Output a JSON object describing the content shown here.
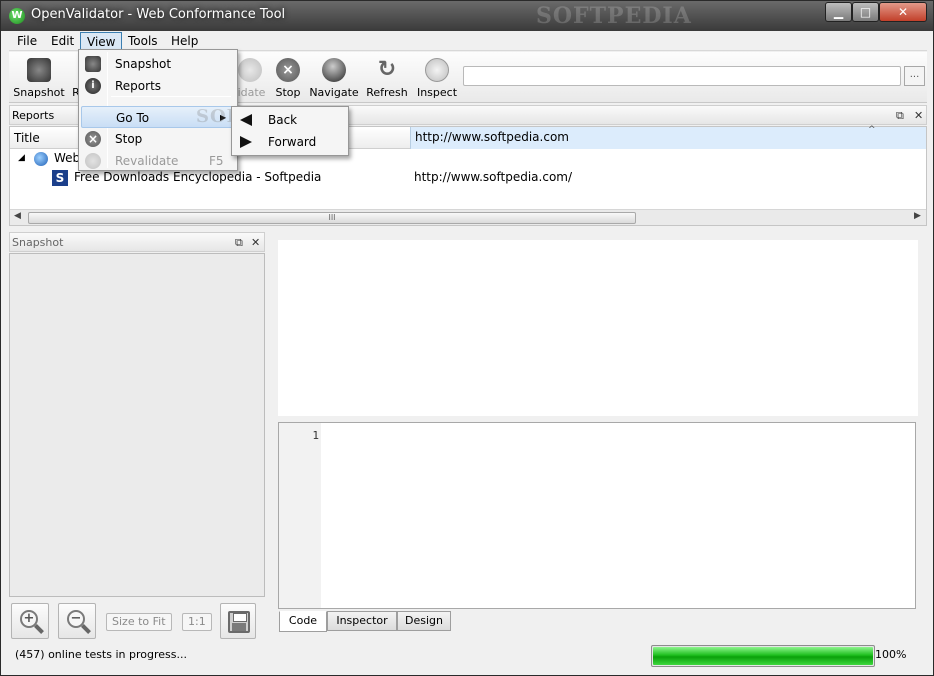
{
  "window": {
    "title": "OpenValidator - Web Conformance Tool",
    "watermark": "SOFTPEDIA",
    "min": "▁",
    "max": "□",
    "close": "✕"
  },
  "menubar": {
    "items": [
      "File",
      "Edit",
      "View",
      "Tools",
      "Help"
    ]
  },
  "toolbar": {
    "snapshot": "Snapshot",
    "reports_partial": "R",
    "revalidate_partial": "lidate",
    "stop": "Stop",
    "navigate": "Navigate",
    "refresh": "Refresh",
    "inspect": "Inspect",
    "address_value": "",
    "browse_btn": "..."
  },
  "reports_panel": {
    "header": "Reports",
    "columns": {
      "title": "Title",
      "url": "http://www.softpedia.com"
    },
    "rows": [
      {
        "title": "Web",
        "url": ""
      },
      {
        "title": "Free Downloads Encyclopedia - Softpedia",
        "url": "http://www.softpedia.com/"
      }
    ]
  },
  "snapshot_panel": {
    "header": "Snapshot",
    "size_to_fit": "Size to Fit",
    "one_to_one": "1:1"
  },
  "editor": {
    "line_number": "1"
  },
  "tabs": [
    "Code",
    "Inspector",
    "Design"
  ],
  "status": {
    "message": "(457)  online tests in progress...",
    "progress": 100,
    "progress_label": "100%"
  },
  "view_menu": {
    "items": [
      {
        "label": "Snapshot",
        "shortcut": ""
      },
      {
        "label": "Reports",
        "shortcut": ""
      },
      {
        "label": "Go To",
        "shortcut": ""
      },
      {
        "label": "Stop",
        "shortcut": ""
      },
      {
        "label": "Revalidate",
        "shortcut": "F5"
      }
    ],
    "goto_sub": [
      "Back",
      "Forward"
    ]
  },
  "colors": {
    "progress": "#1fbf1f",
    "selection": "#dcecfc"
  }
}
